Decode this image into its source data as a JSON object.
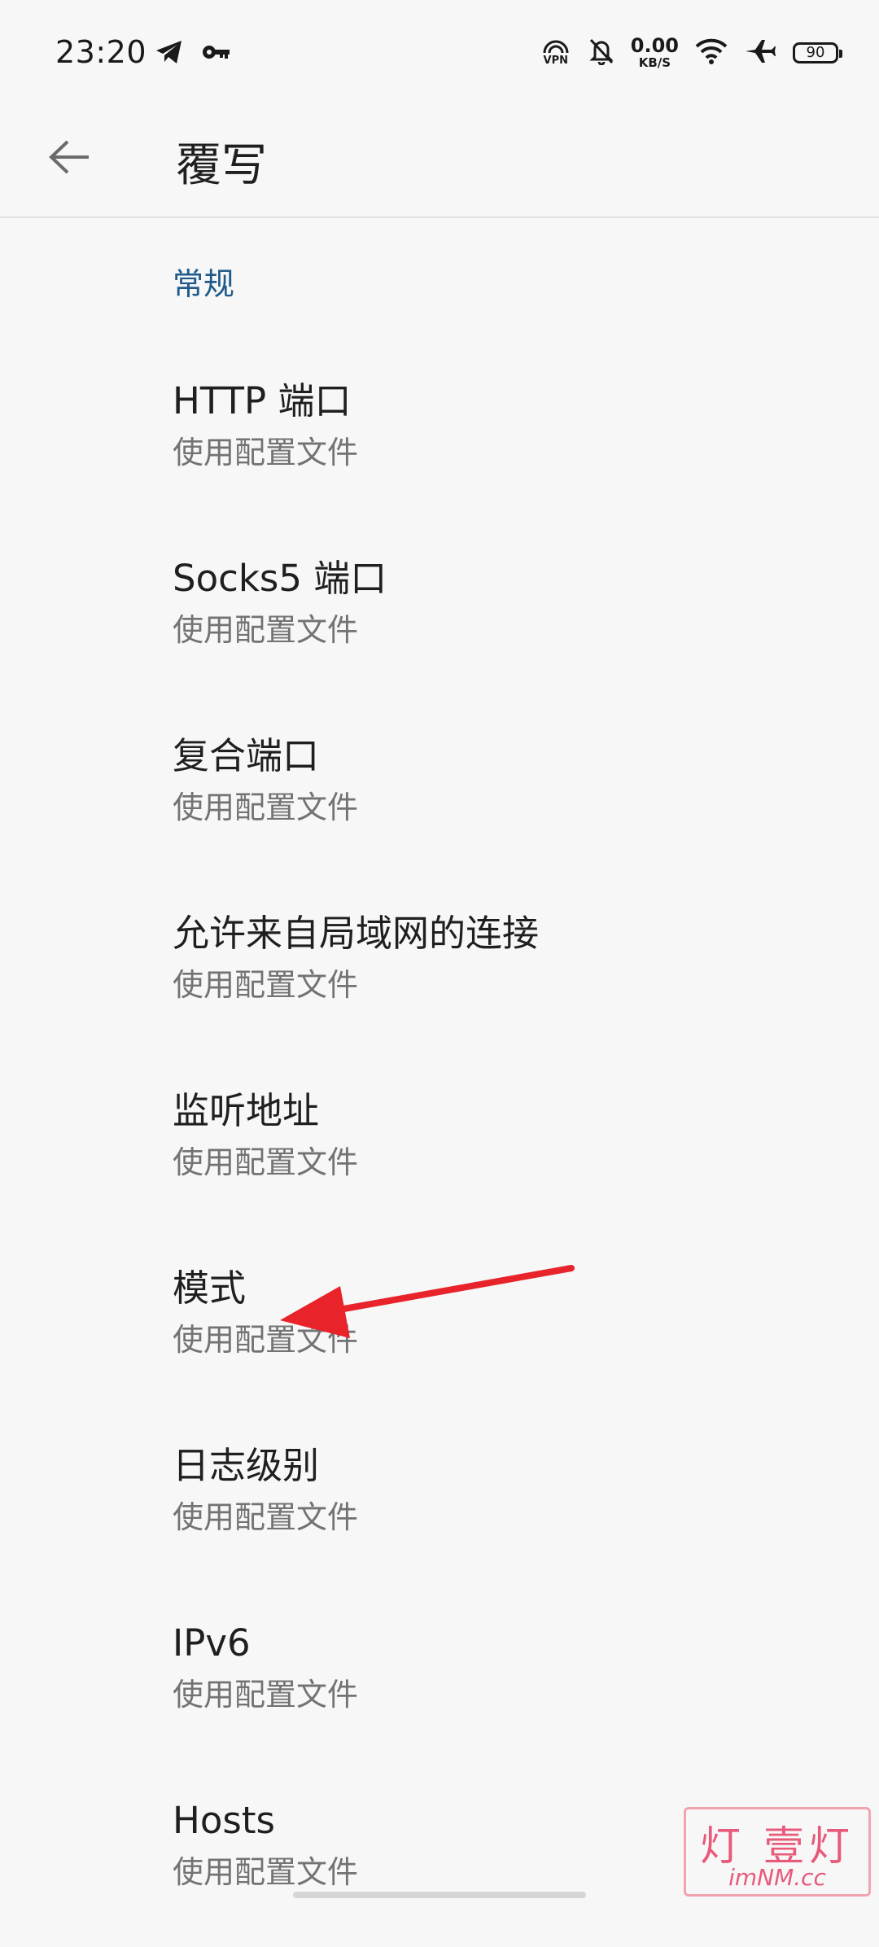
{
  "status_bar": {
    "time": "23:20",
    "left_icons": [
      "telegram-icon",
      "key-icon"
    ],
    "right_icons": [
      "vpn-icon",
      "bell-off-icon",
      "wifi-icon",
      "airplane-icon"
    ],
    "vpn_label": "VPN",
    "net_speed_value": "0.00",
    "net_speed_unit": "KB/S",
    "battery_level": "90"
  },
  "toolbar": {
    "back_icon": "arrow-left-icon",
    "title": "覆写"
  },
  "section": {
    "header": "常规"
  },
  "preferences": [
    {
      "title": "HTTP 端口",
      "summary": "使用配置文件"
    },
    {
      "title": "Socks5 端口",
      "summary": "使用配置文件"
    },
    {
      "title": "复合端口",
      "summary": "使用配置文件"
    },
    {
      "title": "允许来自局域网的连接",
      "summary": "使用配置文件"
    },
    {
      "title": "监听地址",
      "summary": "使用配置文件"
    },
    {
      "title": "模式",
      "summary": "使用配置文件"
    },
    {
      "title": "日志级别",
      "summary": "使用配置文件"
    },
    {
      "title": "IPv6",
      "summary": "使用配置文件"
    },
    {
      "title": "Hosts",
      "summary": "使用配置文件"
    }
  ],
  "watermark": {
    "text_top": "灯 壹灯",
    "text_bottom": "imNM.cc"
  },
  "colors": {
    "background": "#f7f7f8",
    "section_header": "#1f5a8a",
    "summary_text": "#737373",
    "annotation_arrow": "#e8232a"
  }
}
